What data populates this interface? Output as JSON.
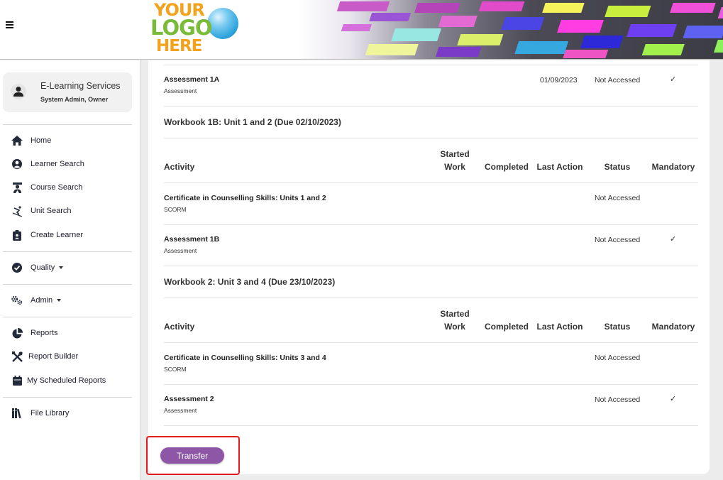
{
  "header": {
    "logo": {
      "line1": "YOUR",
      "line2": "LOGO",
      "line3": "HERE"
    }
  },
  "sidebar": {
    "user": {
      "name": "E-Learning Services",
      "role": "System Admin, Owner"
    },
    "items": [
      {
        "label": "Home",
        "icon": "home-icon"
      },
      {
        "label": "Learner Search",
        "icon": "user-circle-icon"
      },
      {
        "label": "Course Search",
        "icon": "teacher-icon"
      },
      {
        "label": "Unit Search",
        "icon": "skier-icon"
      },
      {
        "label": "Create Learner",
        "icon": "clipboard-user-icon"
      },
      {
        "label": "Quality",
        "icon": "check-circle-icon"
      },
      {
        "label": "Admin",
        "icon": "gears-icon"
      },
      {
        "label": "Reports",
        "icon": "pie-chart-icon"
      },
      {
        "label": "Report Builder",
        "icon": "tools-icon"
      },
      {
        "label": "My Scheduled Reports",
        "icon": "calendar-icon"
      },
      {
        "label": "File Library",
        "icon": "books-icon"
      }
    ]
  },
  "table": {
    "headers": {
      "activity": "Activity",
      "started": "Started Work",
      "completed": "Completed",
      "last_action": "Last Action",
      "status": "Status",
      "mandatory": "Mandatory"
    },
    "top_row": {
      "title": "Assessment 1A",
      "type": "Assessment",
      "last_action": "01/09/2023",
      "status": "Not Accessed",
      "mandatory": "✓"
    },
    "workbooks": [
      {
        "title": "Workbook 1B: Unit 1 and 2 (Due 02/10/2023)",
        "rows": [
          {
            "title": "Certificate in Counselling Skills: Units 1 and 2",
            "type": "SCORM",
            "status": "Not Accessed",
            "mandatory": ""
          },
          {
            "title": "Assessment 1B",
            "type": "Assessment",
            "status": "Not Accessed",
            "mandatory": "✓"
          }
        ]
      },
      {
        "title": "Workbook 2: Unit 3 and 4 (Due 23/10/2023)",
        "rows": [
          {
            "title": "Certificate in Counselling Skills: Units 3 and 4",
            "type": "SCORM",
            "status": "Not Accessed",
            "mandatory": ""
          },
          {
            "title": "Assessment 2",
            "type": "Assessment",
            "status": "Not Accessed",
            "mandatory": "✓"
          }
        ]
      }
    ]
  },
  "actions": {
    "transfer_label": "Transfer"
  },
  "colors": {
    "accent": "#8e56a6",
    "highlight": "#e41b1b"
  }
}
